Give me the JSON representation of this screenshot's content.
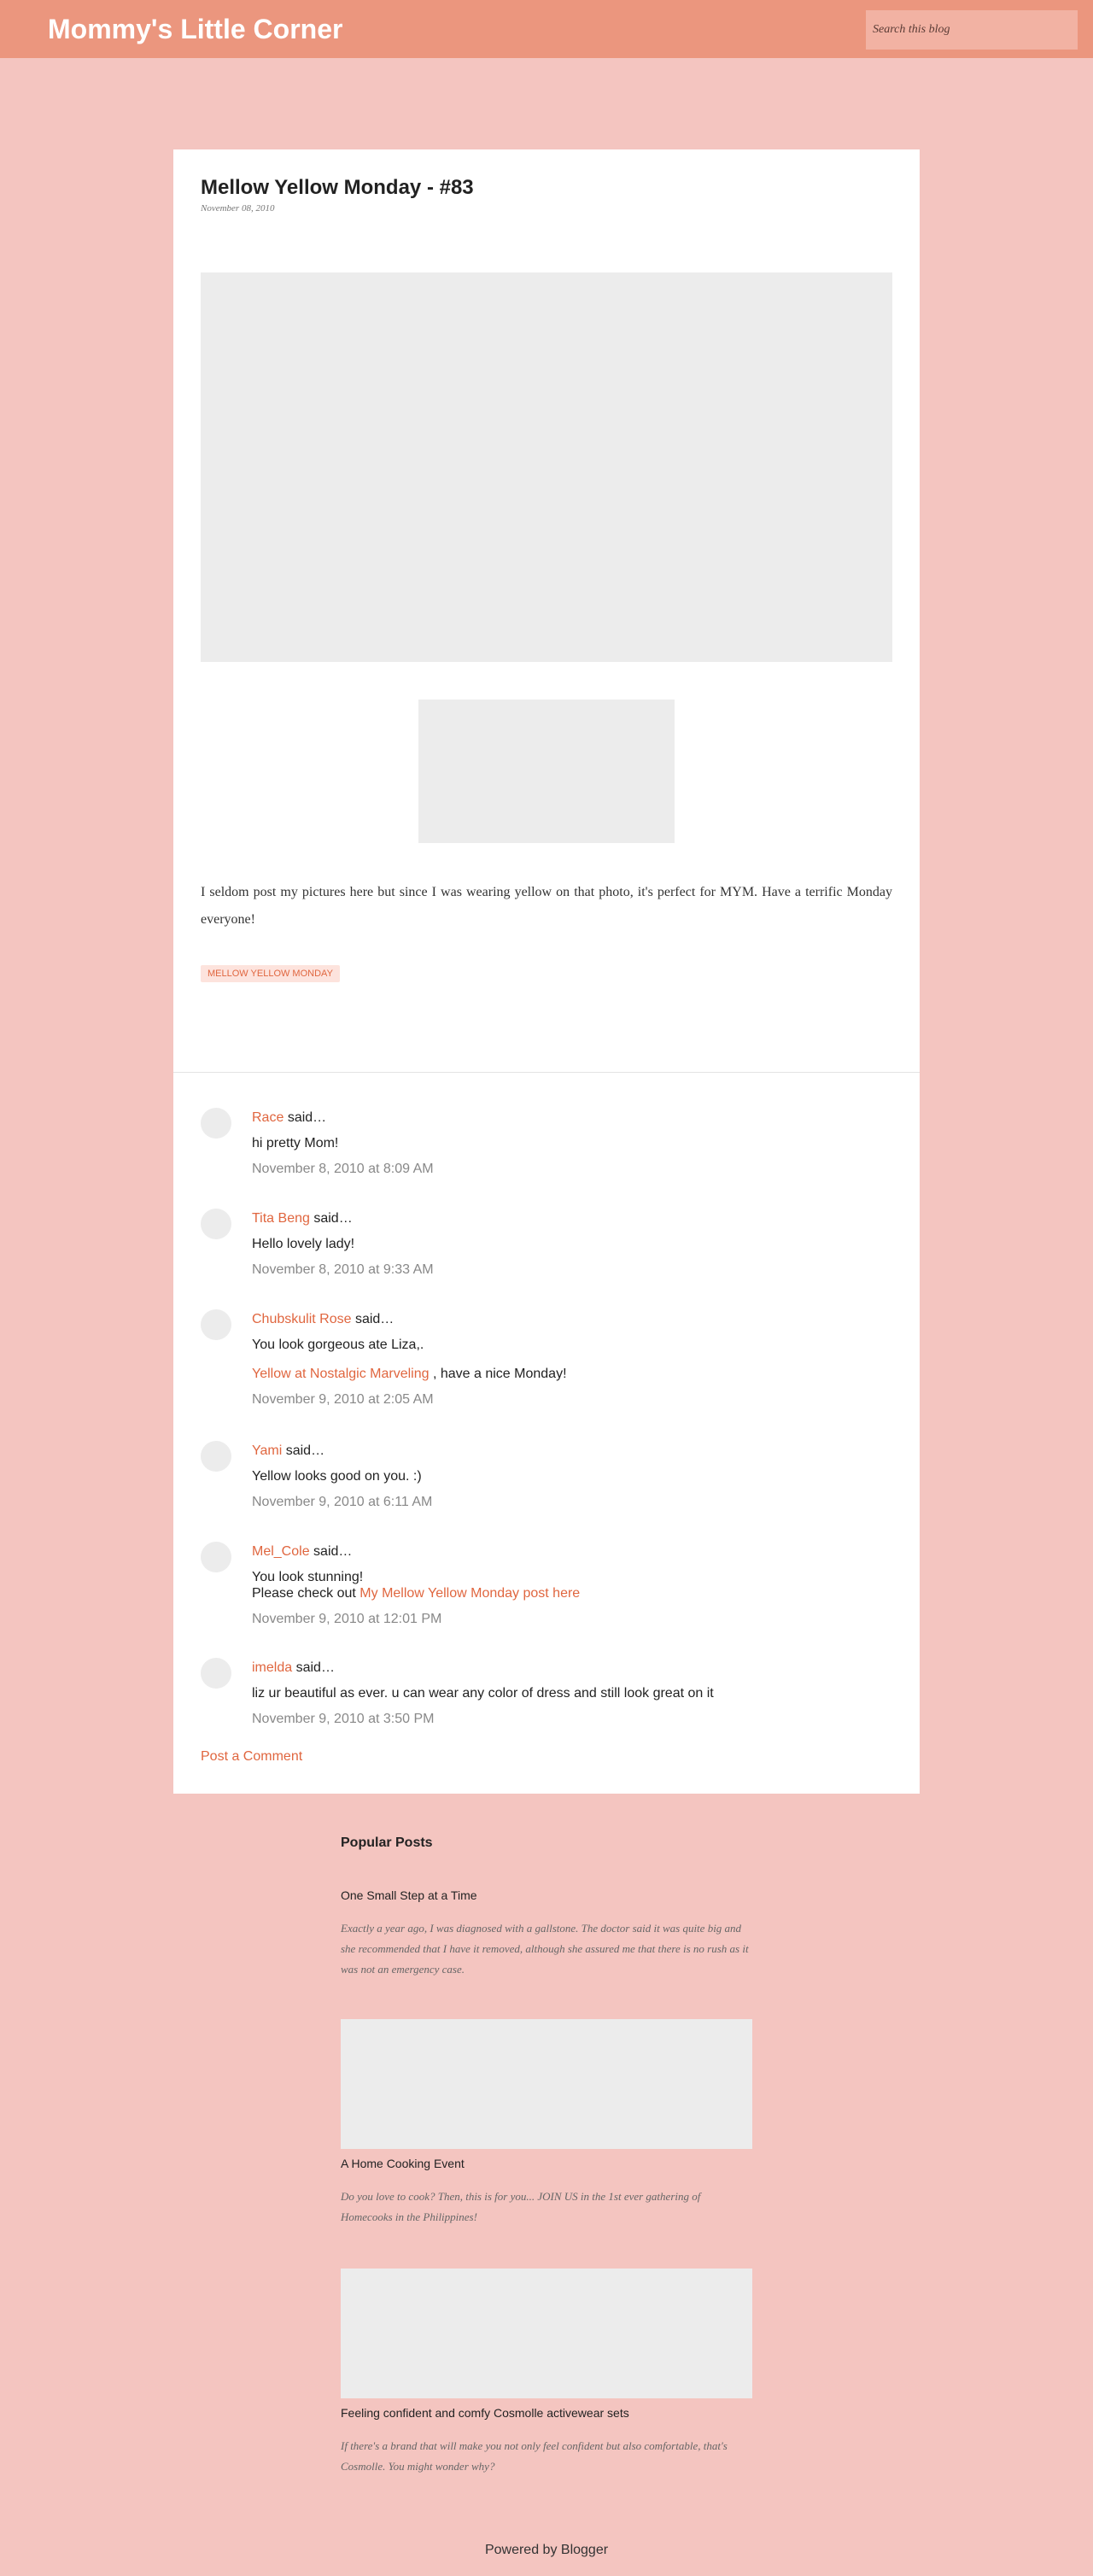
{
  "header": {
    "blog_title": "Mommy's Little Corner",
    "search_placeholder": "Search this blog"
  },
  "post": {
    "title": "Mellow Yellow Monday - #83",
    "date": "November 08, 2010",
    "body": "I seldom post my pictures here but since I was wearing yellow on that photo, it's perfect for MYM.  Have a terrific Monday everyone!",
    "label": "MELLOW YELLOW MONDAY"
  },
  "comments": [
    {
      "author": "Race",
      "said": "said…",
      "text": "hi pretty Mom!",
      "time": "November 8, 2010 at 8:09 AM"
    },
    {
      "author": "Tita Beng",
      "said": "said…",
      "text": "Hello lovely lady!",
      "time": "November 8, 2010 at 9:33 AM"
    },
    {
      "author": "Chubskulit Rose",
      "said": "said…",
      "text": "You look gorgeous ate Liza,.",
      "link": "Yellow at Nostalgic Marveling",
      "after_link": ", have a nice Monday!",
      "time": "November 9, 2010 at 2:05 AM"
    },
    {
      "author": "Yami",
      "said": "said…",
      "text": "Yellow looks good on you. :)",
      "time": "November 9, 2010 at 6:11 AM"
    },
    {
      "author": "Mel_Cole",
      "said": "said…",
      "text": "You look stunning!",
      "pre_link": "Please check out ",
      "link": "My Mellow Yellow Monday post here",
      "time": "November 9, 2010 at 12:01 PM"
    },
    {
      "author": "imelda",
      "said": "said…",
      "text": "liz ur beautiful as ever. u can wear any color of dress and still look great on it",
      "time": "November 9, 2010 at 3:50 PM"
    }
  ],
  "post_comment_label": "Post a Comment",
  "sidebar": {
    "title": "Popular Posts",
    "posts": [
      {
        "title": "One Small Step at a Time",
        "snippet": "Exactly a year ago, I was diagnosed with a gallstone. The doctor said it was quite big and she recommended that I have it removed, although she assured me that there is no rush as it was not an emergency case."
      },
      {
        "title": "A Home Cooking Event",
        "snippet": "Do you love to cook? Then, this is for you... JOIN US in the 1st ever gathering of Homecooks in the Philippines!"
      },
      {
        "title": "Feeling confident and comfy Cosmolle activewear sets",
        "snippet": "If there's a brand that will make you not only feel confident but also comfortable, that's Cosmolle. You might wonder why?"
      }
    ]
  },
  "footer": {
    "text": "Powered by Blogger"
  }
}
